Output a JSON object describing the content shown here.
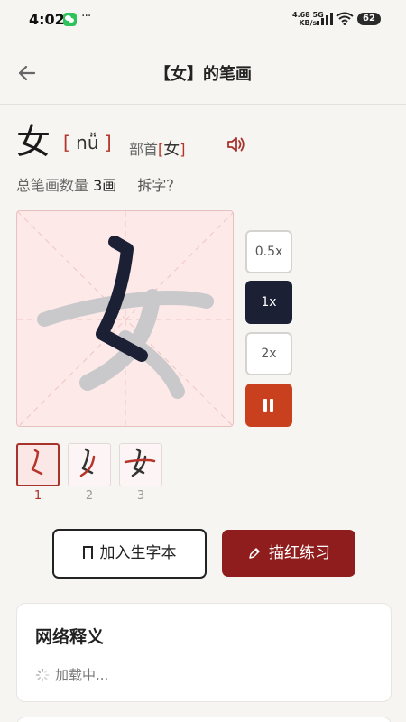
{
  "status_bar": {
    "time": "4:02",
    "more": "···",
    "net_speed_value": "4.68 5G",
    "net_speed_unit": "KB/s",
    "battery": "62"
  },
  "header": {
    "title": "【女】的笔画"
  },
  "character": {
    "glyph": "女",
    "pinyin": "nǚ",
    "radical_label": "部首",
    "radical": "女",
    "bracket_open": "[",
    "bracket_close": "]"
  },
  "stroke_info": {
    "label": "总笔画数量",
    "count": "3画",
    "split_label": "拆字？"
  },
  "speed_options": [
    {
      "label": "0.5x",
      "active": false
    },
    {
      "label": "1x",
      "active": true
    },
    {
      "label": "2x",
      "active": false
    }
  ],
  "stroke_steps": [
    {
      "number": "1",
      "active": true
    },
    {
      "number": "2",
      "active": false
    },
    {
      "number": "3",
      "active": false
    }
  ],
  "actions": {
    "add_vocab": "加入生字本",
    "trace_practice": "描红练习"
  },
  "definition": {
    "title": "网络释义",
    "loading": "加载中..."
  },
  "colors": {
    "accent_red": "#8f1d1d",
    "pause_orange": "#c9401f",
    "active_dark": "#1c2035",
    "stroke_active": "#1c2035",
    "stroke_pending": "#c9c9cc",
    "canvas_bg": "#fde9e8"
  }
}
